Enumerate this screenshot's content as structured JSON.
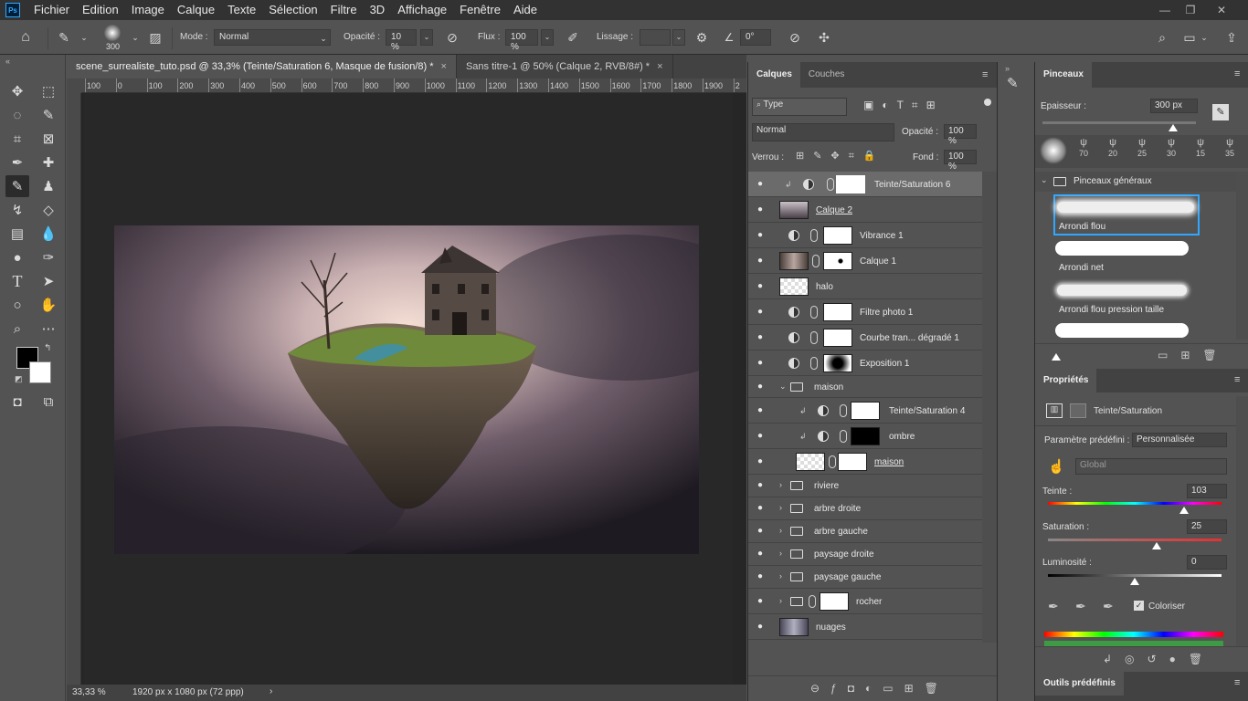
{
  "menubar": {
    "logo": "Ps",
    "items": [
      "Fichier",
      "Edition",
      "Image",
      "Calque",
      "Texte",
      "Sélection",
      "Filtre",
      "3D",
      "Affichage",
      "Fenêtre",
      "Aide"
    ]
  },
  "options": {
    "brush_size": "300",
    "mode_label": "Mode :",
    "mode_value": "Normal",
    "opacity_label": "Opacité :",
    "opacity_value": "10 %",
    "flux_label": "Flux :",
    "flux_value": "100 %",
    "lissage_label": "Lissage :",
    "angle_value": "0°"
  },
  "tabs": [
    {
      "label": "scene_surrealiste_tuto.psd @ 33,3% (Teinte/Saturation 6, Masque de fusion/8) *",
      "close": "×"
    },
    {
      "label": "Sans titre-1 @ 50% (Calque 2, RVB/8#) *",
      "close": "×"
    }
  ],
  "ruler": [
    "100",
    "0",
    "100",
    "200",
    "300",
    "400",
    "500",
    "600",
    "700",
    "800",
    "900",
    "1000",
    "1100",
    "1200",
    "1300",
    "1400",
    "1500",
    "1600",
    "1700",
    "1800",
    "1900",
    "2"
  ],
  "status": {
    "zoom": "33,33 %",
    "doc_info": "1920 px x 1080 px (72 ppp)",
    "arrow": "›"
  },
  "layers_panel": {
    "tab_layers": "Calques",
    "tab_channels": "Couches",
    "filter_type": "Type",
    "blend_mode": "Normal",
    "opacity_label": "Opacité :",
    "opacity_value": "100 %",
    "lock_label": "Verrou :",
    "fill_label": "Fond :",
    "fill_value": "100 %",
    "layers": [
      {
        "name": "Teinte/Saturation 6"
      },
      {
        "name": "Calque 2"
      },
      {
        "name": "Vibrance 1"
      },
      {
        "name": "Calque 1"
      },
      {
        "name": "halo"
      },
      {
        "name": "Filtre photo 1"
      },
      {
        "name": "Courbe tran... dégradé 1"
      },
      {
        "name": "Exposition 1"
      },
      {
        "name": "maison"
      },
      {
        "name": "Teinte/Saturation 4"
      },
      {
        "name": "ombre"
      },
      {
        "name": "maison"
      },
      {
        "name": "riviere"
      },
      {
        "name": "arbre droite"
      },
      {
        "name": "arbre gauche"
      },
      {
        "name": "paysage droite"
      },
      {
        "name": "paysage gauche"
      },
      {
        "name": "rocher"
      },
      {
        "name": "nuages"
      }
    ]
  },
  "brushes_panel": {
    "title": "Pinceaux",
    "thickness_label": "Epaisseur :",
    "thickness_value": "300 px",
    "thickness_level": 0.85,
    "recent_sizes": [
      "70",
      "20",
      "25",
      "30",
      "15",
      "35"
    ],
    "group": "Pinceaux généraux",
    "brushes": [
      "Arrondi flou",
      "Arrondi net",
      "Arrondi flou pression taille"
    ]
  },
  "properties_panel": {
    "title": "Propriétés",
    "type": "Teinte/Saturation",
    "preset_label": "Paramètre prédéfini :",
    "preset_value": "Personnalisée",
    "channel": "Global",
    "hue_label": "Teinte :",
    "hue_value": "103",
    "saturation_label": "Saturation :",
    "saturation_value": "25",
    "lightness_label": "Luminosité :",
    "lightness_value": "0",
    "colorize_label": "Coloriser",
    "colorize_checked": true
  },
  "presets_panel": {
    "title": "Outils prédéfinis"
  }
}
